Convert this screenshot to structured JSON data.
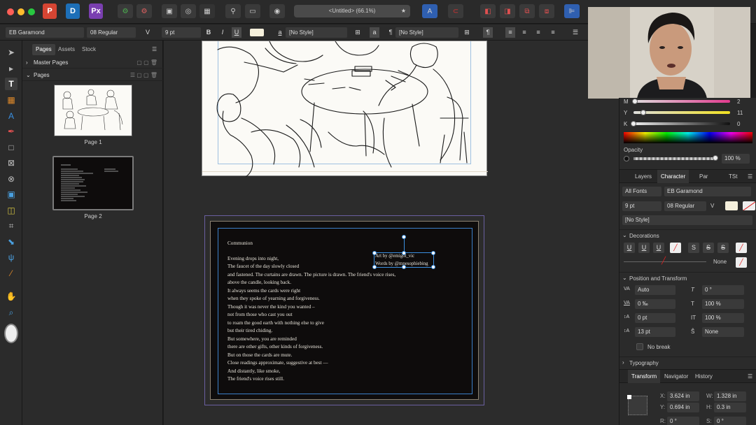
{
  "toolbar": {
    "doc_title": "<Untitled> (66.1%)",
    "persona_labels": [
      "P",
      "D",
      "Px"
    ]
  },
  "context": {
    "font_family": "EB Garamond",
    "font_style": "08 Regular",
    "font_size": "9 pt",
    "char_style": "[No Style]",
    "para_style": "[No Style]"
  },
  "pages_panel": {
    "tabs": [
      "Pages",
      "Assets",
      "Stock"
    ],
    "master_pages": "Master Pages",
    "pages": "Pages",
    "page1_label": "Page 1",
    "page2_label": "Page 2"
  },
  "poem": {
    "title": "Communion",
    "credit1": "Art by @emigot_vic",
    "credit2": "Words by @mnesophiebing",
    "lines": [
      "Evening drops into night,",
      "The faucet of the day slowly closed",
      "and fastened. The curtains are drawn. The picture is drawn. The friend's voice rises,",
      "above the candle, looking back.",
      "It always seems the cards were right",
      "when they spoke of yearning and forgiveness.",
      "Though it was never the kind you wanted –",
      "not from those who cast you out",
      "to roam the good earth with nothing else to give",
      "but their tired chiding.",
      "But somewhere, you are reminded",
      "there are other gifts, other kinds of forgiveness.",
      "But on those the cards are mute.",
      "Close readings approximate, suggestive at best —",
      "And distantly, like smoke,",
      "The friend's voice rises still."
    ]
  },
  "color": {
    "m_label": "M",
    "m_value": "2",
    "y_label": "Y",
    "y_value": "11",
    "k_label": "K",
    "k_value": "0",
    "opacity_label": "Opacity",
    "opacity_value": "100 %"
  },
  "right_tabs": [
    "Layers",
    "Character",
    "Par",
    "TSt"
  ],
  "character": {
    "all_fonts": "All Fonts",
    "font": "EB Garamond",
    "size": "9 pt",
    "style": "08 Regular",
    "char_style": "[No Style]",
    "decorations": "Decorations",
    "none_label": "None",
    "pos_transform": "Position and Transform",
    "kerning": "Auto",
    "rotation": "0 °",
    "tracking": "0 ‰",
    "hscale": "100 %",
    "baseline": "0 pt",
    "vscale": "100 %",
    "leading": "13 pt",
    "skew": "None",
    "no_break": "No break",
    "typography": "Typography"
  },
  "transform": {
    "tabs": [
      "Transform",
      "Navigator",
      "History"
    ],
    "x_label": "X:",
    "x": "3.624 in",
    "y_label": "Y:",
    "y": "0.694 in",
    "w_label": "W:",
    "w": "1.328 in",
    "h_label": "H:",
    "h": "0.3 in",
    "r_label": "R:",
    "r": "0 °",
    "s_label": "S:",
    "s": "0 °"
  },
  "colors": {
    "accent": "#2f6fd6",
    "page_bg": "#0e0c0c",
    "bleed": "#6a5fa0",
    "margin_blue": "#3b7fc9"
  }
}
